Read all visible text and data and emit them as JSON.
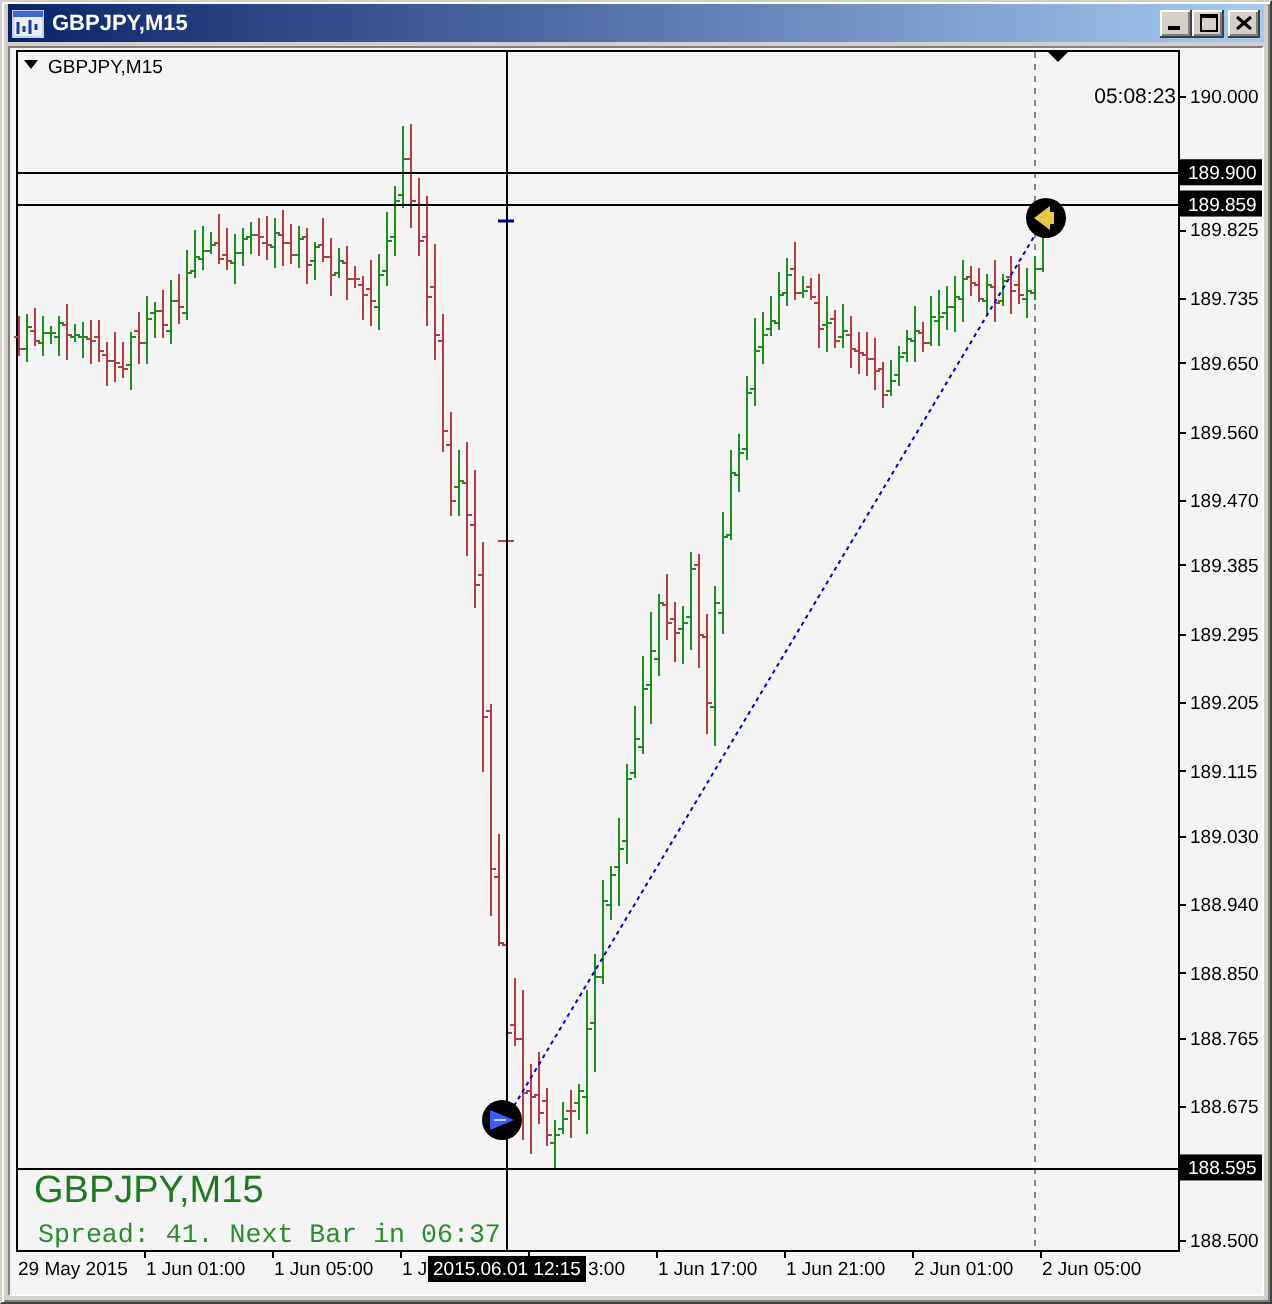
{
  "window": {
    "title": "GBPJPY,M15"
  },
  "chart": {
    "symbol_label": "GBPJPY,M15",
    "countdown": "05:08:23",
    "price_axis": [
      "190.000",
      "189.825",
      "189.735",
      "189.650",
      "189.560",
      "189.470",
      "189.385",
      "189.295",
      "189.205",
      "189.115",
      "189.030",
      "188.940",
      "188.850",
      "188.765",
      "188.675",
      "188.500"
    ],
    "price_lines": [
      "189.900",
      "189.859",
      "188.595"
    ],
    "time_axis": [
      "29 May 2015",
      "1 Jun 01:00",
      "1 Jun 05:00",
      "1 J",
      "3:00",
      "1 Jun 17:00",
      "1 Jun 21:00",
      "2 Jun 01:00",
      "2 Jun 05:00"
    ],
    "crosshair": {
      "time": "2015.06.01 12:15"
    },
    "overlay": {
      "title": "GBPJPY,M15",
      "status": "Spread: 41. Next Bar in 06:37"
    }
  }
}
